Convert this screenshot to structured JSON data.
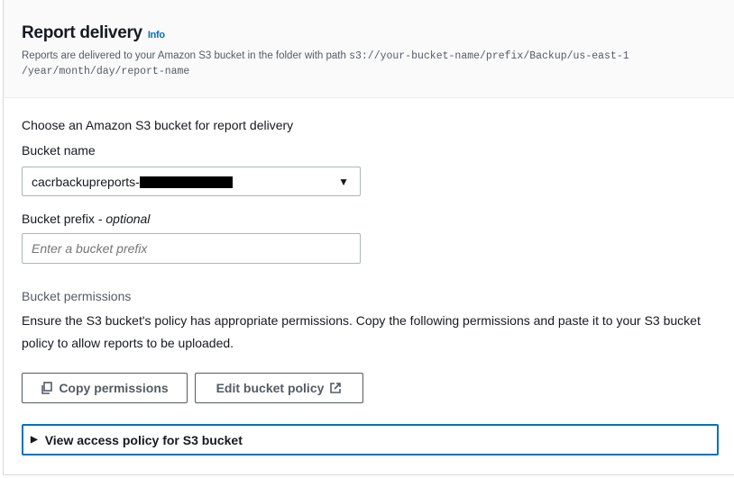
{
  "header": {
    "title": "Report delivery",
    "info": "Info",
    "description_prefix": "Reports are delivered to your Amazon S3 bucket in the folder with path ",
    "path": "s3://your-bucket-name/prefix/Backup/us-east-1 /year/month/day/report-name"
  },
  "form": {
    "choose_label": "Choose an Amazon S3 bucket for report delivery",
    "bucket_name_label": "Bucket name",
    "bucket_name_value": "cacrbackupreports-",
    "prefix_label": "Bucket prefix - ",
    "prefix_optional": "optional",
    "prefix_placeholder": "Enter a bucket prefix",
    "permissions_label": "Bucket permissions",
    "permissions_text": "Ensure the S3 bucket's policy has appropriate permissions. Copy the following permissions and paste it to your S3 bucket policy to allow reports to be uploaded."
  },
  "buttons": {
    "copy": "Copy permissions",
    "edit": "Edit bucket policy"
  },
  "expander": {
    "label": "View access policy for S3 bucket"
  }
}
